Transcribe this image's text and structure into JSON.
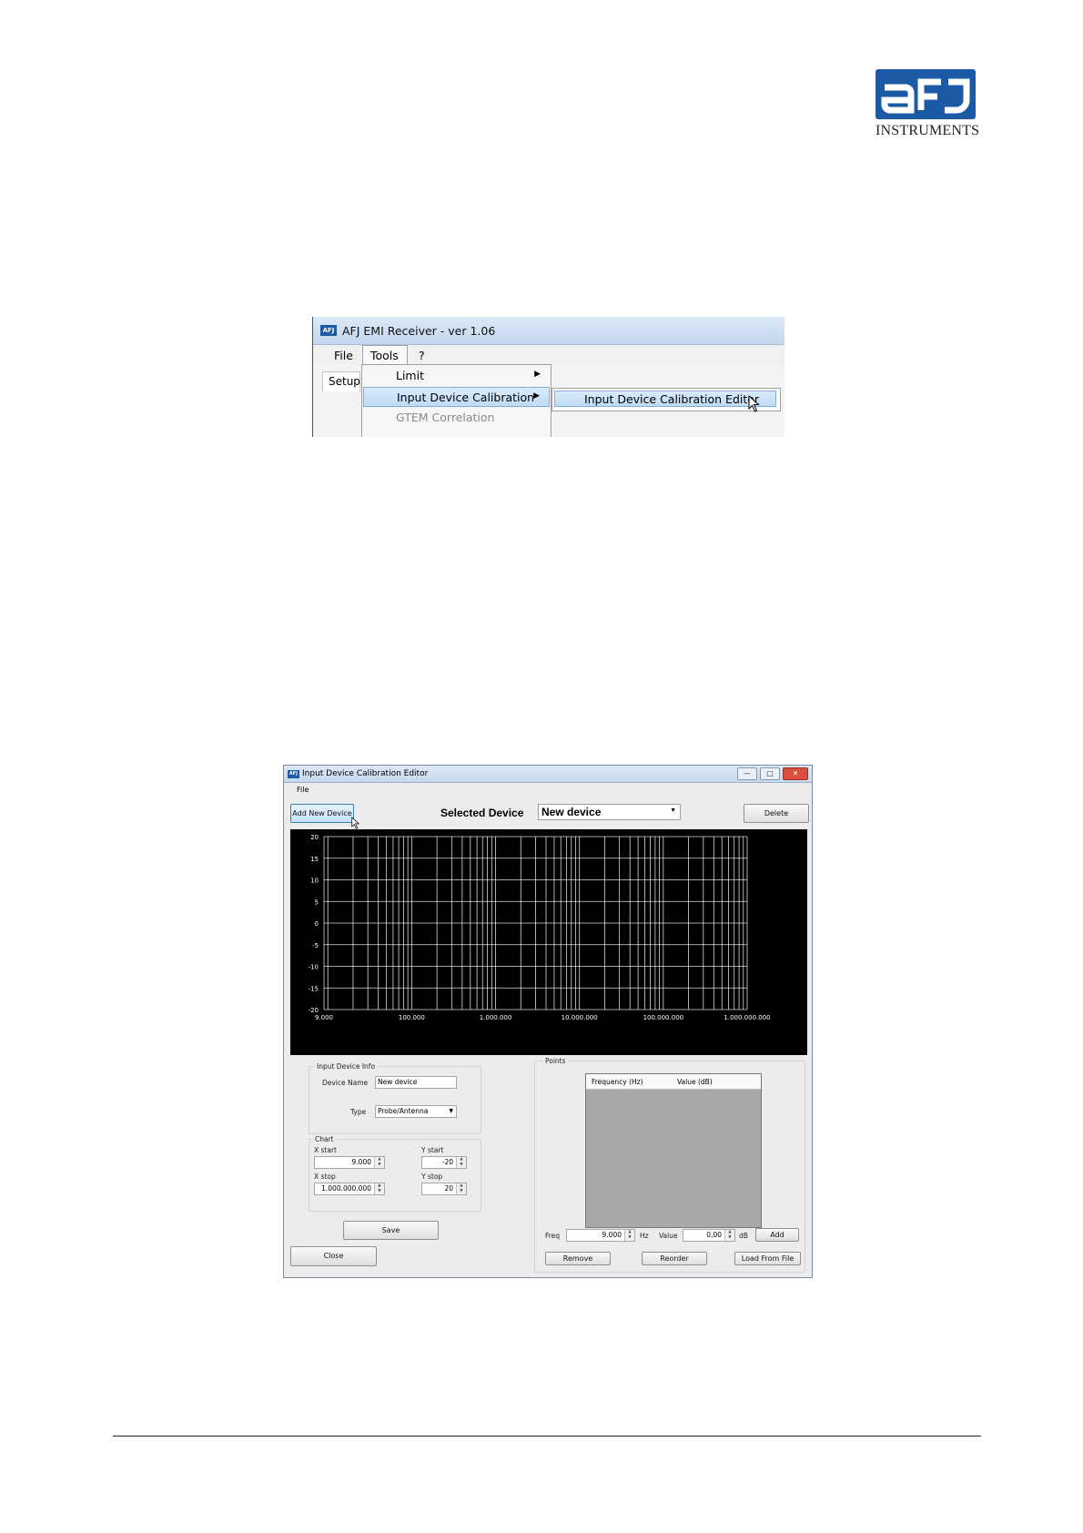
{
  "logo": {
    "brand": "aFJ",
    "text": "INSTRUMENTS",
    "color": "#1d5aa6"
  },
  "screenshot1": {
    "title": "AFJ EMI Receiver - ver 1.06",
    "app_icon": "AFJ",
    "menu": {
      "file": "File",
      "tools": "Tools",
      "help": "?"
    },
    "tab_setup": "Setup",
    "tools_menu": [
      {
        "label": "Limit",
        "submenu": true
      },
      {
        "label": "Input Device Calibration",
        "submenu": true,
        "highlighted": true
      },
      {
        "label": "GTEM Correlation",
        "disabled": true
      }
    ],
    "submenu_item": "Input Device Calibration Editor"
  },
  "screenshot2": {
    "title": "Input Device Calibration Editor",
    "app_icon": "AFJ",
    "menu_file": "File",
    "add_new_device": "Add New Device",
    "selected_device_label": "Selected Device",
    "selected_device_value": "New device",
    "delete": "Delete",
    "info_group": "Input Device Info",
    "device_name_label": "Device Name",
    "device_name_value": "New device",
    "type_label": "Type",
    "type_value": "Probe/Antenna",
    "chart_group": "Chart",
    "xstart_label": "X start",
    "xstart_value": "9.000",
    "xstop_label": "X stop",
    "xstop_value": "1.000.000.000",
    "ystart_label": "Y start",
    "ystart_value": "-20",
    "ystop_label": "Y stop",
    "ystop_value": "20",
    "save": "Save",
    "close": "Close",
    "points_group": "Points",
    "col_freq": "Frequency (Hz)",
    "col_value": "Value (dB)",
    "freq_label": "Freq",
    "freq_value": "9.000",
    "hz_unit": "Hz",
    "value_label": "Value",
    "value_value": "0,00",
    "db_unit": "dB",
    "add": "Add",
    "remove": "Remove",
    "reorder": "Reorder",
    "load_from_file": "Load From File"
  },
  "chart_data": {
    "type": "line",
    "x_scale": "log",
    "xlim": [
      9000,
      1000000000
    ],
    "ylim": [
      -20,
      20
    ],
    "x_ticks": [
      9000,
      100000,
      1000000,
      10000000,
      100000000,
      1000000000
    ],
    "x_tick_labels": [
      "9.000",
      "100.000",
      "1.000.000",
      "10.000.000",
      "100.000.000",
      "1.000.000.000"
    ],
    "y_ticks": [
      20,
      15,
      10,
      5,
      0,
      -5,
      -10,
      -15,
      -20
    ],
    "y_tick_labels": [
      "20",
      "15",
      "10",
      "5",
      "0",
      "-5",
      "-10",
      "-15",
      "-20"
    ],
    "grid": true,
    "series": [],
    "background": "#000000",
    "grid_color": "#ffffff"
  }
}
